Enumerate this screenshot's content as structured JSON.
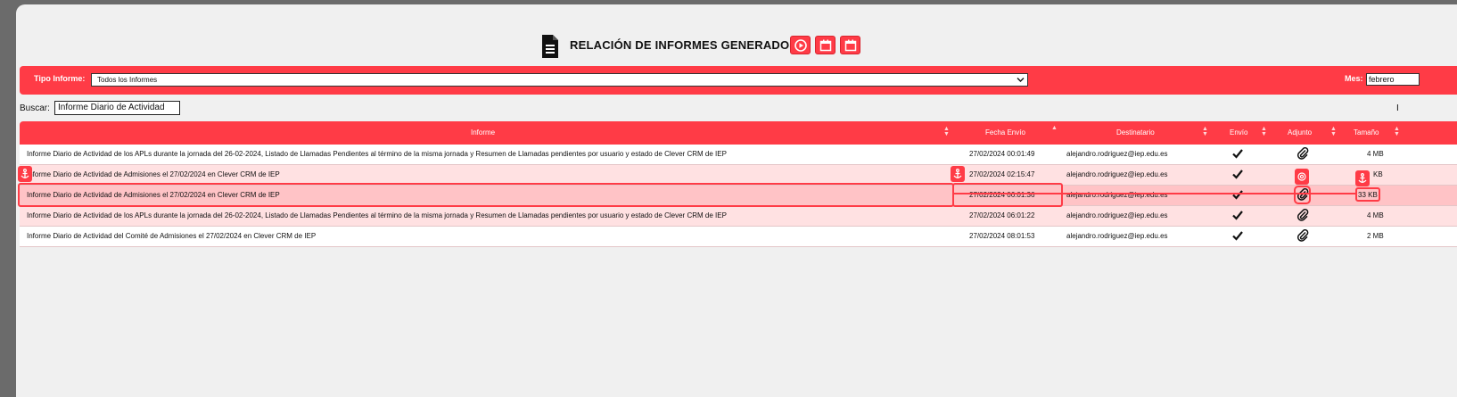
{
  "header": {
    "title": "RELACIÓN DE INFORMES GENERADOS",
    "icons": [
      "document-icon",
      "play-circle-icon",
      "calendar-icon",
      "calendar-icon"
    ]
  },
  "filters": {
    "type_label": "Tipo Informe:",
    "type_value": "Todos los Informes",
    "month_label": "Mes:",
    "month_value": "febrero"
  },
  "search": {
    "label": "Buscar:",
    "value": "Informe Diario de Actividad",
    "right_text": "I"
  },
  "table": {
    "columns": [
      "Informe",
      "Fecha Envío",
      "Destinatario",
      "Envío",
      "Adjunto",
      "Tamaño"
    ],
    "rows": [
      {
        "informe": "Informe Diario de Actividad de los APLs durante la jornada del 26-02-2024, Listado de Llamadas Pendientes al término de la misma jornada y Resumen de Llamadas pendientes por usuario y estado de Clever CRM de IEP",
        "fecha": "27/02/2024 00:01:49",
        "destinatario": "alejandro.rodriguez@iep.edu.es",
        "tamano": "4 MB"
      },
      {
        "informe": "Informe Diario de Actividad de Admisiones el 27/02/2024 en Clever CRM de IEP",
        "fecha": "27/02/2024 02:15:47",
        "destinatario": "alejandro.rodriguez@iep.edu.es",
        "tamano": "KB"
      },
      {
        "informe": "Informe Diario de Actividad de Admisiones el 27/02/2024 en Clever CRM de IEP",
        "fecha": "27/02/2024 06:01:36",
        "destinatario": "alejandro.rodriguez@iep.edu.es",
        "tamano": "33 KB"
      },
      {
        "informe": "Informe Diario de Actividad de los APLs durante la jornada del 26-02-2024, Listado de Llamadas Pendientes al término de la misma jornada y Resumen de Llamadas pendientes por usuario y estado de Clever CRM de IEP",
        "fecha": "27/02/2024 06:01:22",
        "destinatario": "alejandro.rodriguez@iep.edu.es",
        "tamano": "4 MB"
      },
      {
        "informe": "Informe Diario de Actividad del Comité de Admisiones el 27/02/2024 en Clever CRM de IEP",
        "fecha": "27/02/2024 08:01:53",
        "destinatario": "alejandro.rodriguez@iep.edu.es",
        "tamano": "2 MB"
      }
    ]
  },
  "colors": {
    "accent": "#ff3b46",
    "row_alt": "#ffe1e2",
    "row_selected": "#ffc3c6",
    "background": "#f0f0f0"
  }
}
